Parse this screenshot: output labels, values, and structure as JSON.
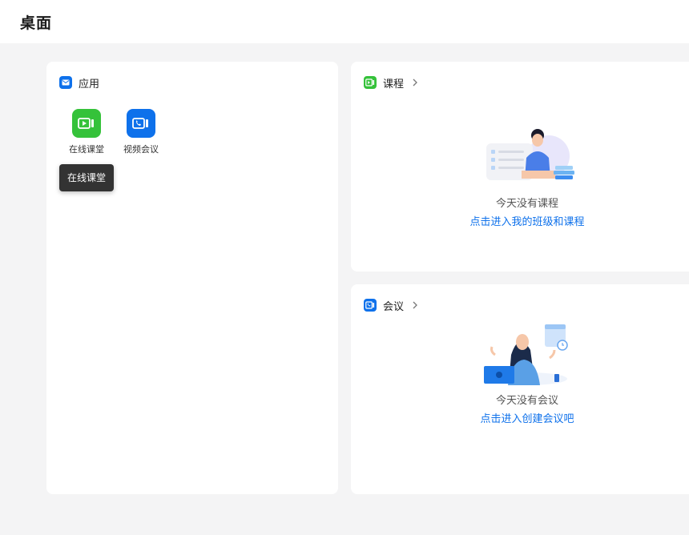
{
  "page": {
    "title": "桌面"
  },
  "colors": {
    "accent_blue": "#0e71eb",
    "accent_green": "#35c23a",
    "tooltip_bg": "#333333",
    "page_bg": "#f4f4f5"
  },
  "apps_card": {
    "title": "应用",
    "icon": "envelope-icon",
    "apps": [
      {
        "label": "在线课堂",
        "icon": "video-play-icon",
        "color": "#35c23a"
      },
      {
        "label": "视频会议",
        "icon": "phone-video-icon",
        "color": "#0e71eb"
      }
    ],
    "tooltip": "在线课堂"
  },
  "courses_card": {
    "title": "课程",
    "icon": "video-play-icon",
    "empty_text": "今天没有课程",
    "empty_link": "点击进入我的班级和课程"
  },
  "meetings_card": {
    "title": "会议",
    "icon": "phone-video-icon",
    "empty_text": "今天没有会议",
    "empty_link": "点击进入创建会议吧"
  }
}
